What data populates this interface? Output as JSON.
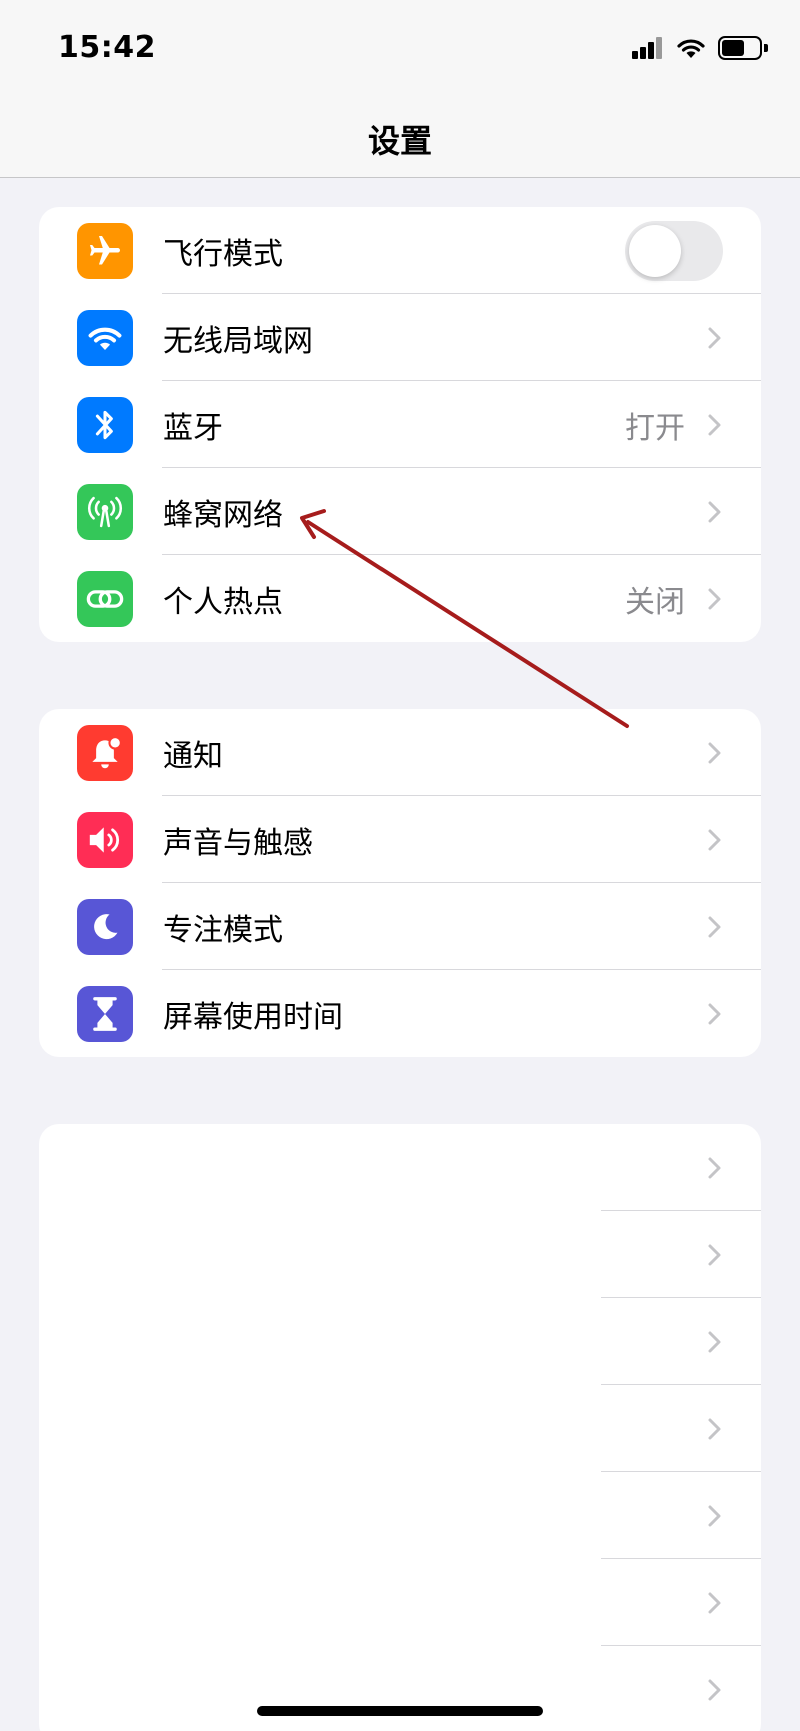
{
  "status_bar": {
    "time": "15:42",
    "battery_level": 0.6
  },
  "nav": {
    "title": "设置"
  },
  "group1": [
    {
      "label": "飞行模式",
      "icon": "airplane-icon",
      "color": "#ff9500",
      "toggle": false
    },
    {
      "label": "无线局域网",
      "icon": "wifi-icon",
      "color": "#007aff",
      "value": ""
    },
    {
      "label": "蓝牙",
      "icon": "bluetooth-icon",
      "color": "#007aff",
      "value": "打开"
    },
    {
      "label": "蜂窝网络",
      "icon": "antenna-icon",
      "color": "#34c759",
      "value": ""
    },
    {
      "label": "个人热点",
      "icon": "link-icon",
      "color": "#34c759",
      "value": "关闭"
    }
  ],
  "group2": [
    {
      "label": "通知",
      "icon": "notification-bell-icon",
      "color": "#ff3b30"
    },
    {
      "label": "声音与触感",
      "icon": "speaker-icon",
      "color": "#ff2d55"
    },
    {
      "label": "专注模式",
      "icon": "moon-icon",
      "color": "#5856d6"
    },
    {
      "label": "屏幕使用时间",
      "icon": "hourglass-icon",
      "color": "#5856d6"
    }
  ],
  "annotation": {
    "color": "#a61c1c"
  }
}
